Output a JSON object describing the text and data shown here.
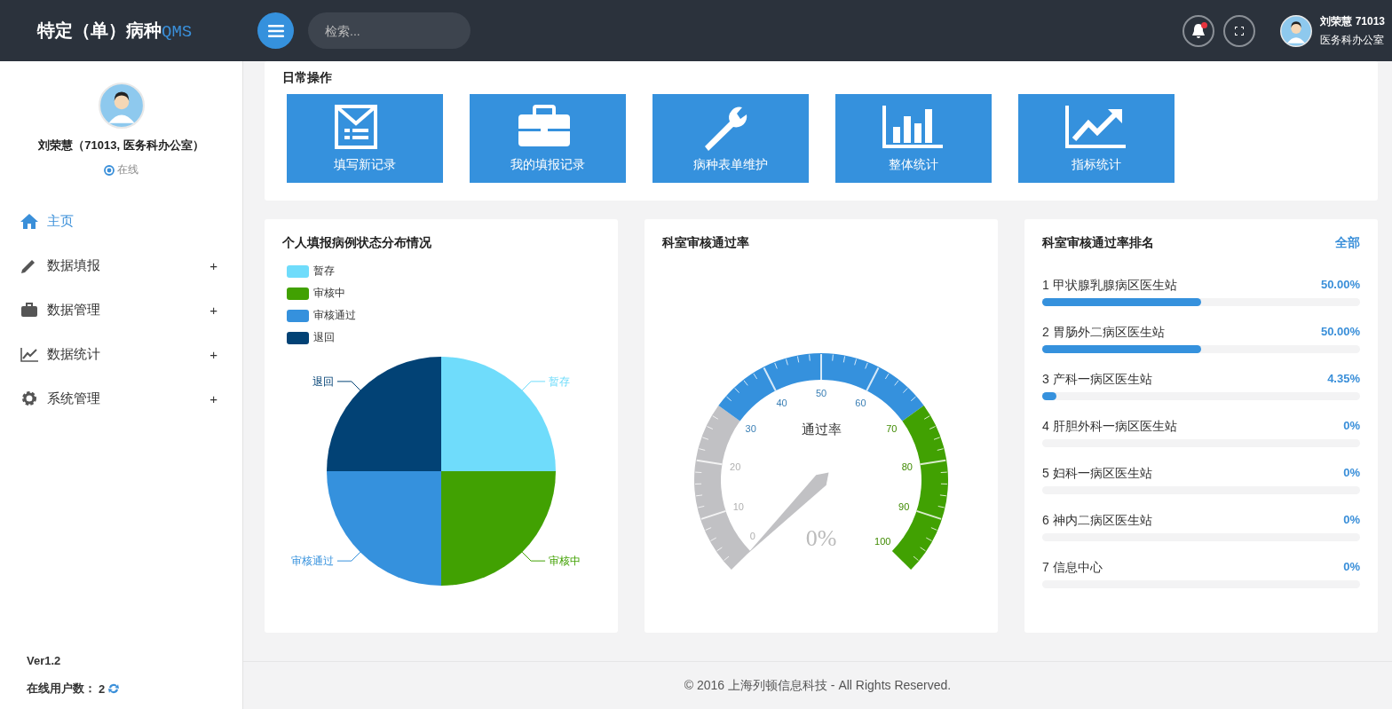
{
  "header": {
    "logo": {
      "title": "特定（单）病种",
      "suffix": "QMS"
    },
    "search": {
      "placeholder": "检索..."
    },
    "notifications": {
      "unread": true
    },
    "user": {
      "name": "刘荣慧 71013",
      "department": "医务科办公室"
    }
  },
  "sidebar": {
    "profile": {
      "name": "刘荣慧（71013, 医务科办公室）",
      "status": "在线"
    },
    "items": [
      {
        "kind": "home",
        "label": "主页",
        "selected": true
      },
      {
        "kind": "pencil",
        "label": "数据填报",
        "selected": false,
        "expander": "+"
      },
      {
        "kind": "briefcase",
        "label": "数据管理",
        "selected": false,
        "expander": "+"
      },
      {
        "kind": "chart",
        "label": "数据统计",
        "selected": false,
        "expander": "+"
      },
      {
        "kind": "gear",
        "label": "系统管理",
        "selected": false,
        "expander": "+"
      }
    ],
    "version": "Ver1.2",
    "online_label": "在线用户数：",
    "online_count": "2"
  },
  "quick_actions": {
    "title": "日常操作",
    "items": [
      {
        "kind": "form",
        "label": "填写新记录"
      },
      {
        "kind": "briefcase",
        "label": "我的填报记录"
      },
      {
        "kind": "wrench",
        "label": "病种表单维护"
      },
      {
        "kind": "bars",
        "label": "整体统计"
      },
      {
        "kind": "trend",
        "label": "指标统计"
      }
    ]
  },
  "status_chart": {
    "title": "个人填报病例状态分布情况",
    "legend": [
      {
        "label": "暂存",
        "color": "#6fdcfb"
      },
      {
        "label": "审核中",
        "color": "#41a102"
      },
      {
        "label": "审核通过",
        "color": "#3591dd"
      },
      {
        "label": "退回",
        "color": "#024275"
      }
    ],
    "chart_data": {
      "type": "pie",
      "categories": [
        "暂存",
        "审核中",
        "审核通过",
        "退回"
      ],
      "values": [
        25,
        25,
        25,
        25
      ]
    }
  },
  "approval_gauge": {
    "title": "科室审核通过率",
    "label": "通过率",
    "reading": "0%",
    "ticks": [
      "0",
      "10",
      "20",
      "30",
      "40",
      "50",
      "60",
      "70",
      "80",
      "90",
      "100"
    ]
  },
  "ranking": {
    "title": "科室审核通过率排名",
    "link": "全部",
    "rows": [
      {
        "label": "1 甲状腺乳腺病区医生站",
        "value": "50.00%",
        "level": 0.5
      },
      {
        "label": "2 胃肠外二病区医生站",
        "value": "50.00%",
        "level": 0.5
      },
      {
        "label": "3 产科一病区医生站",
        "value": "4.35%",
        "level": 0.0435
      },
      {
        "label": "4 肝胆外科一病区医生站",
        "value": "0%",
        "level": 0
      },
      {
        "label": "5 妇科一病区医生站",
        "value": "0%",
        "level": 0
      },
      {
        "label": "6 神内二病区医生站",
        "value": "0%",
        "level": 0
      },
      {
        "label": "7 信息中心",
        "value": "0%",
        "level": 0
      }
    ]
  },
  "footer": "© 2016 上海列顿信息科技 - All Rights Reserved."
}
